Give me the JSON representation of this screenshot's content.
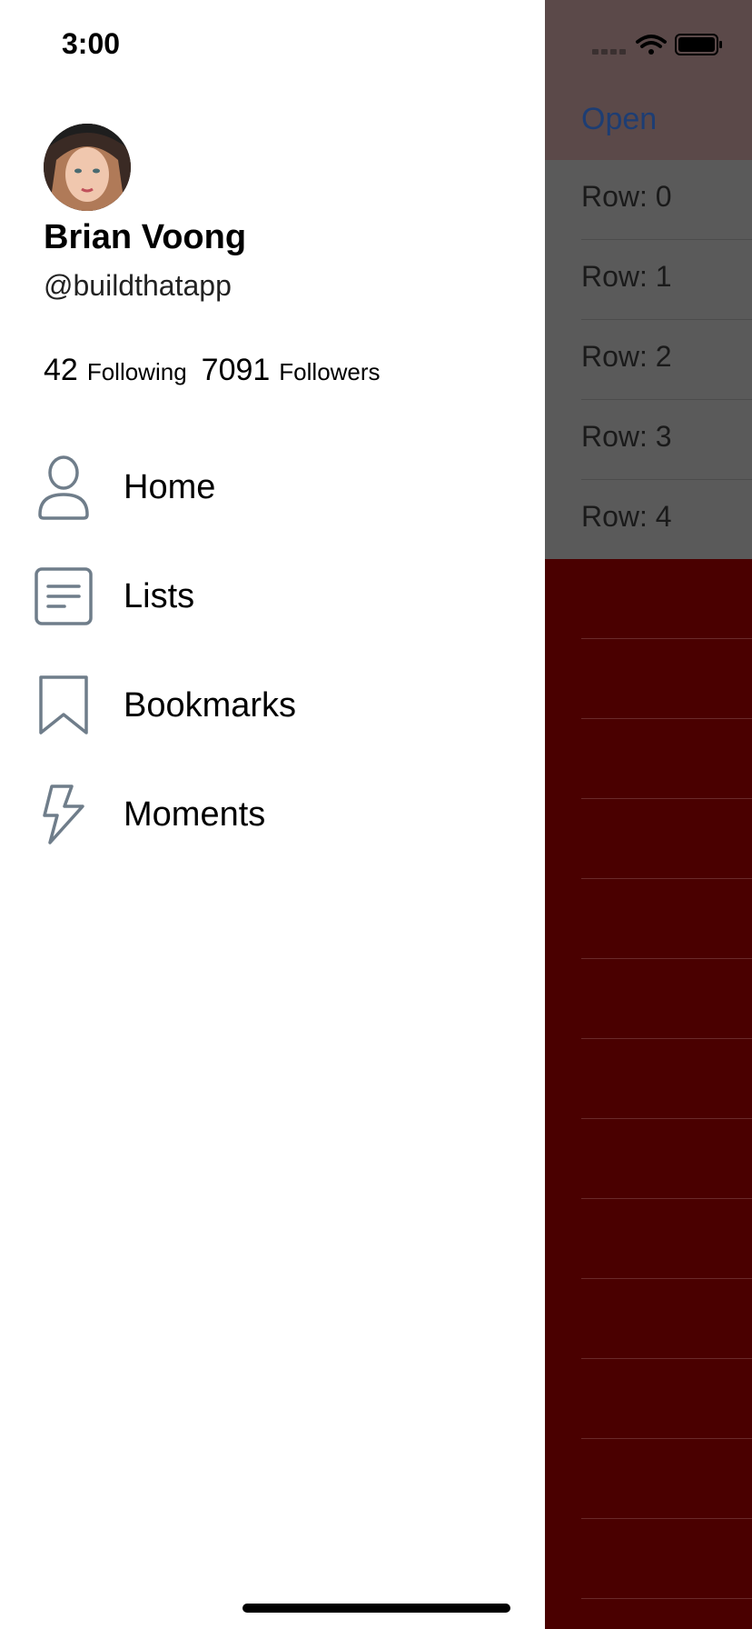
{
  "status_bar": {
    "time": "3:00"
  },
  "profile": {
    "name": "Brian Voong",
    "handle": "@buildthatapp",
    "following_count": "42",
    "following_label": "Following",
    "followers_count": "7091",
    "followers_label": "Followers"
  },
  "menu": [
    {
      "label": "Home",
      "icon": "person-icon"
    },
    {
      "label": "Lists",
      "icon": "list-icon"
    },
    {
      "label": "Bookmarks",
      "icon": "bookmark-icon"
    },
    {
      "label": "Moments",
      "icon": "lightning-icon"
    }
  ],
  "background_app": {
    "nav_button": "Open",
    "rows": [
      "Row: 0",
      "Row: 1",
      "Row: 2",
      "Row: 3",
      "Row: 4"
    ]
  },
  "colors": {
    "icon_gray": "#6f7d8a",
    "background_red": "#4a0000"
  }
}
